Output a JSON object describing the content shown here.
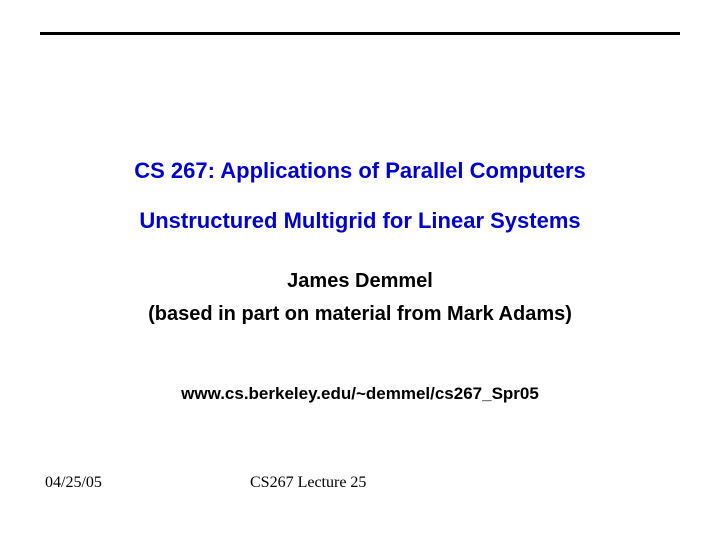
{
  "title": {
    "line1": "CS 267: Applications of Parallel Computers",
    "line2": "Unstructured Multigrid for Linear Systems"
  },
  "author": {
    "name": "James Demmel",
    "note": "(based in part on material from Mark Adams)"
  },
  "url": "www.cs.berkeley.edu/~demmel/cs267_Spr05",
  "footer": {
    "date": "04/25/05",
    "lecture": "CS267 Lecture 25"
  }
}
